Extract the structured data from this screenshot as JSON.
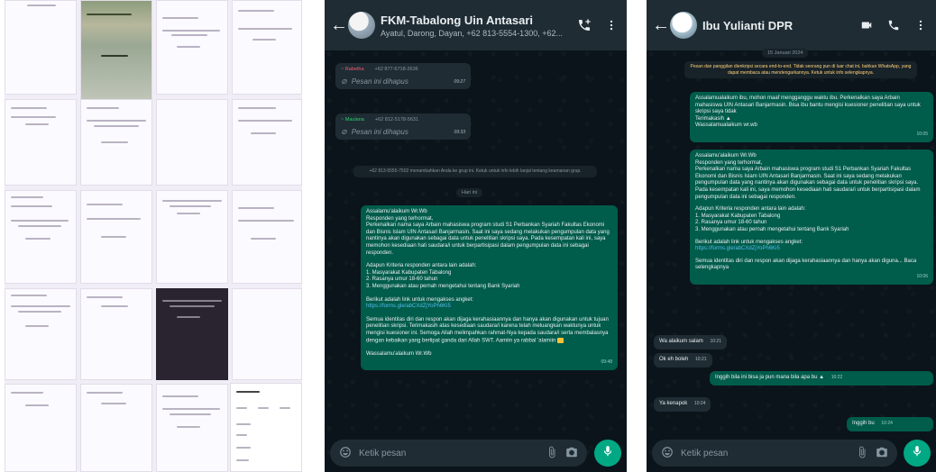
{
  "chat1": {
    "name": "FKM-Tabalong Uin Antasari",
    "members": "Ayatul, Darong, Dayan, +62 813-5554-1300, +62...",
    "deleted_1": {
      "sender": "~ Rabetha",
      "phone": "+62 877-5718-2636",
      "text": "Pesan ini dihapus",
      "time": "09:27"
    },
    "deleted_2": {
      "sender": "~ Maulana",
      "phone": "+62 812-5178-5631",
      "text": "Pesan ini dihapus",
      "time": "09:33"
    },
    "system_notice": "+62 813-5555-7502 menambahkan Anda ke grup ini. Ketuk untuk info lebih lanjut tentang keamanan grup.",
    "date_label": "Hari ini",
    "message": {
      "greeting": "Assalamu'alaikum Wr.Wb",
      "p1": "Responden yang terhormat,",
      "p2": "Perkenalkan nama saya Arbain mahasiswa program studi S1 Perbankan Syariah Fakultas Ekonomi dan Bisnis Islam UIN Antasari Banjarmasin. Saat ini saya sedang melakukan pengumpulan data yang nantinya akan digunakan sebagai data untuk penelitian skripsi saya. Pada kesempatan kali ini, saya memohon kesediaan hati saudara/i untuk berpartisipasi dalam pengumpulan data ini sebagai responden.",
      "criteria_title": "Adapun Kriteria responden antara lain adalah:",
      "criteria": [
        "1. Masyarakat Kabupaten Tabalong",
        "2. Rasanya umur 18-60 tahun",
        "3. Menggunakan atau pernah mengetahui tentang Bank Syariah"
      ],
      "link_intro": "Berikut adalah link untuk mengakses angket:",
      "link": "https://forms.gle/abCXdZjYoPh6Ki5",
      "p3": "Semua identitas diri dan respon akan dijaga kerahasiaannya dan hanya akan digunakan untuk tujuan penelitian skripsi. Terimakasih atas kesediaan saudara/i karena telah meluangkan waktunya untuk mengisi kuesioner ini. Semoga Allah melimpahkan rahmat-Nya kepada saudara/i serta membalasnya dengan kebaikan yang berlipat ganda dari Allah SWT. Aamiin ya rabbal 'alamiin",
      "closing": "Wassalamu'alaikum Wr.Wb",
      "time": "09:48"
    },
    "input_placeholder": "Ketik pesan"
  },
  "chat2": {
    "name": "Ibu Yulianti DPR",
    "date_label": "15 Januari 2024",
    "encryption_notice": "Pesan dan panggilan dienkripsi secara end-to-end. Tidak seorang pun di luar chat ini, bahkan WhatsApp, yang dapat membaca atau mendengarkannya. Ketuk untuk info selengkapnya.",
    "out_1": {
      "text": "Assalamualaikum ibu, mohon maaf mengganggu waktu ibu. Perkenalkan saya Arbain mahasiswa UIN Antasari Banjarmasin. Bisa ibu bantu mengisi kuesioner penelitian saya untuk skripsi saya tidak",
      "thanks": "Terimakasih",
      "sign": "Wassalamualaikum wr.wb",
      "time": "10:05"
    },
    "out_2": {
      "greeting": "Assalamu'alaikum Wr.Wb",
      "p1": "Responden yang terhormat,",
      "p2": "Perkenalkan nama saya Arbain mahasiswa program studi S1 Perbankan Syariah Fakultas Ekonomi dan Bisnis Islam UIN Antasari Banjarmasin. Saat ini saya sedang melakukan pengumpulan data yang nantinya akan digunakan sebagai data untuk penelitian skripsi saya. Pada kesempatan kali ini, saya memohon kesediaan hati saudara/i untuk berpartisipasi dalam pengumpulan data ini sebagai responden.",
      "criteria_title": "Adapun Kriteria responden antara lain adalah:",
      "criteria": [
        "1. Masyarakat Kabupaten Tabalong",
        "2. Rasanya umur 18-60 tahun",
        "3. Menggunakan atau pernah mengetahui tentang Bank Syariah"
      ],
      "link_intro": "Berikut adalah link untuk mengakses angket:",
      "link": "https://forms.gle/abCXdZjYoPh6Ki5",
      "p3": "Semua identitas diri dan respon akan dijaga kerahasiaannya dan hanya akan diguna... Baca selengkapnya",
      "time": "10:06"
    },
    "in_1": {
      "text": "Wa alaikum salam",
      "time": "10:21"
    },
    "in_2": {
      "text": "Ok eh boleh",
      "time": "10:21"
    },
    "out_3": {
      "text": "Inggih bila ini bisa ja pun mana bila apa bu",
      "time": "10:22"
    },
    "in_3": {
      "text": "Ya kenapok",
      "time": "10:24"
    },
    "out_4": {
      "text": "Inggih bu",
      "time": "10:24"
    },
    "input_placeholder": "Ketik pesan"
  },
  "colors": {
    "header": "#1f2c34",
    "chat_bg": "#0b141a",
    "outgoing": "#005c4b",
    "incoming": "#1f2c34",
    "accent": "#00a884",
    "gallery_bg": "#f1edf6"
  }
}
